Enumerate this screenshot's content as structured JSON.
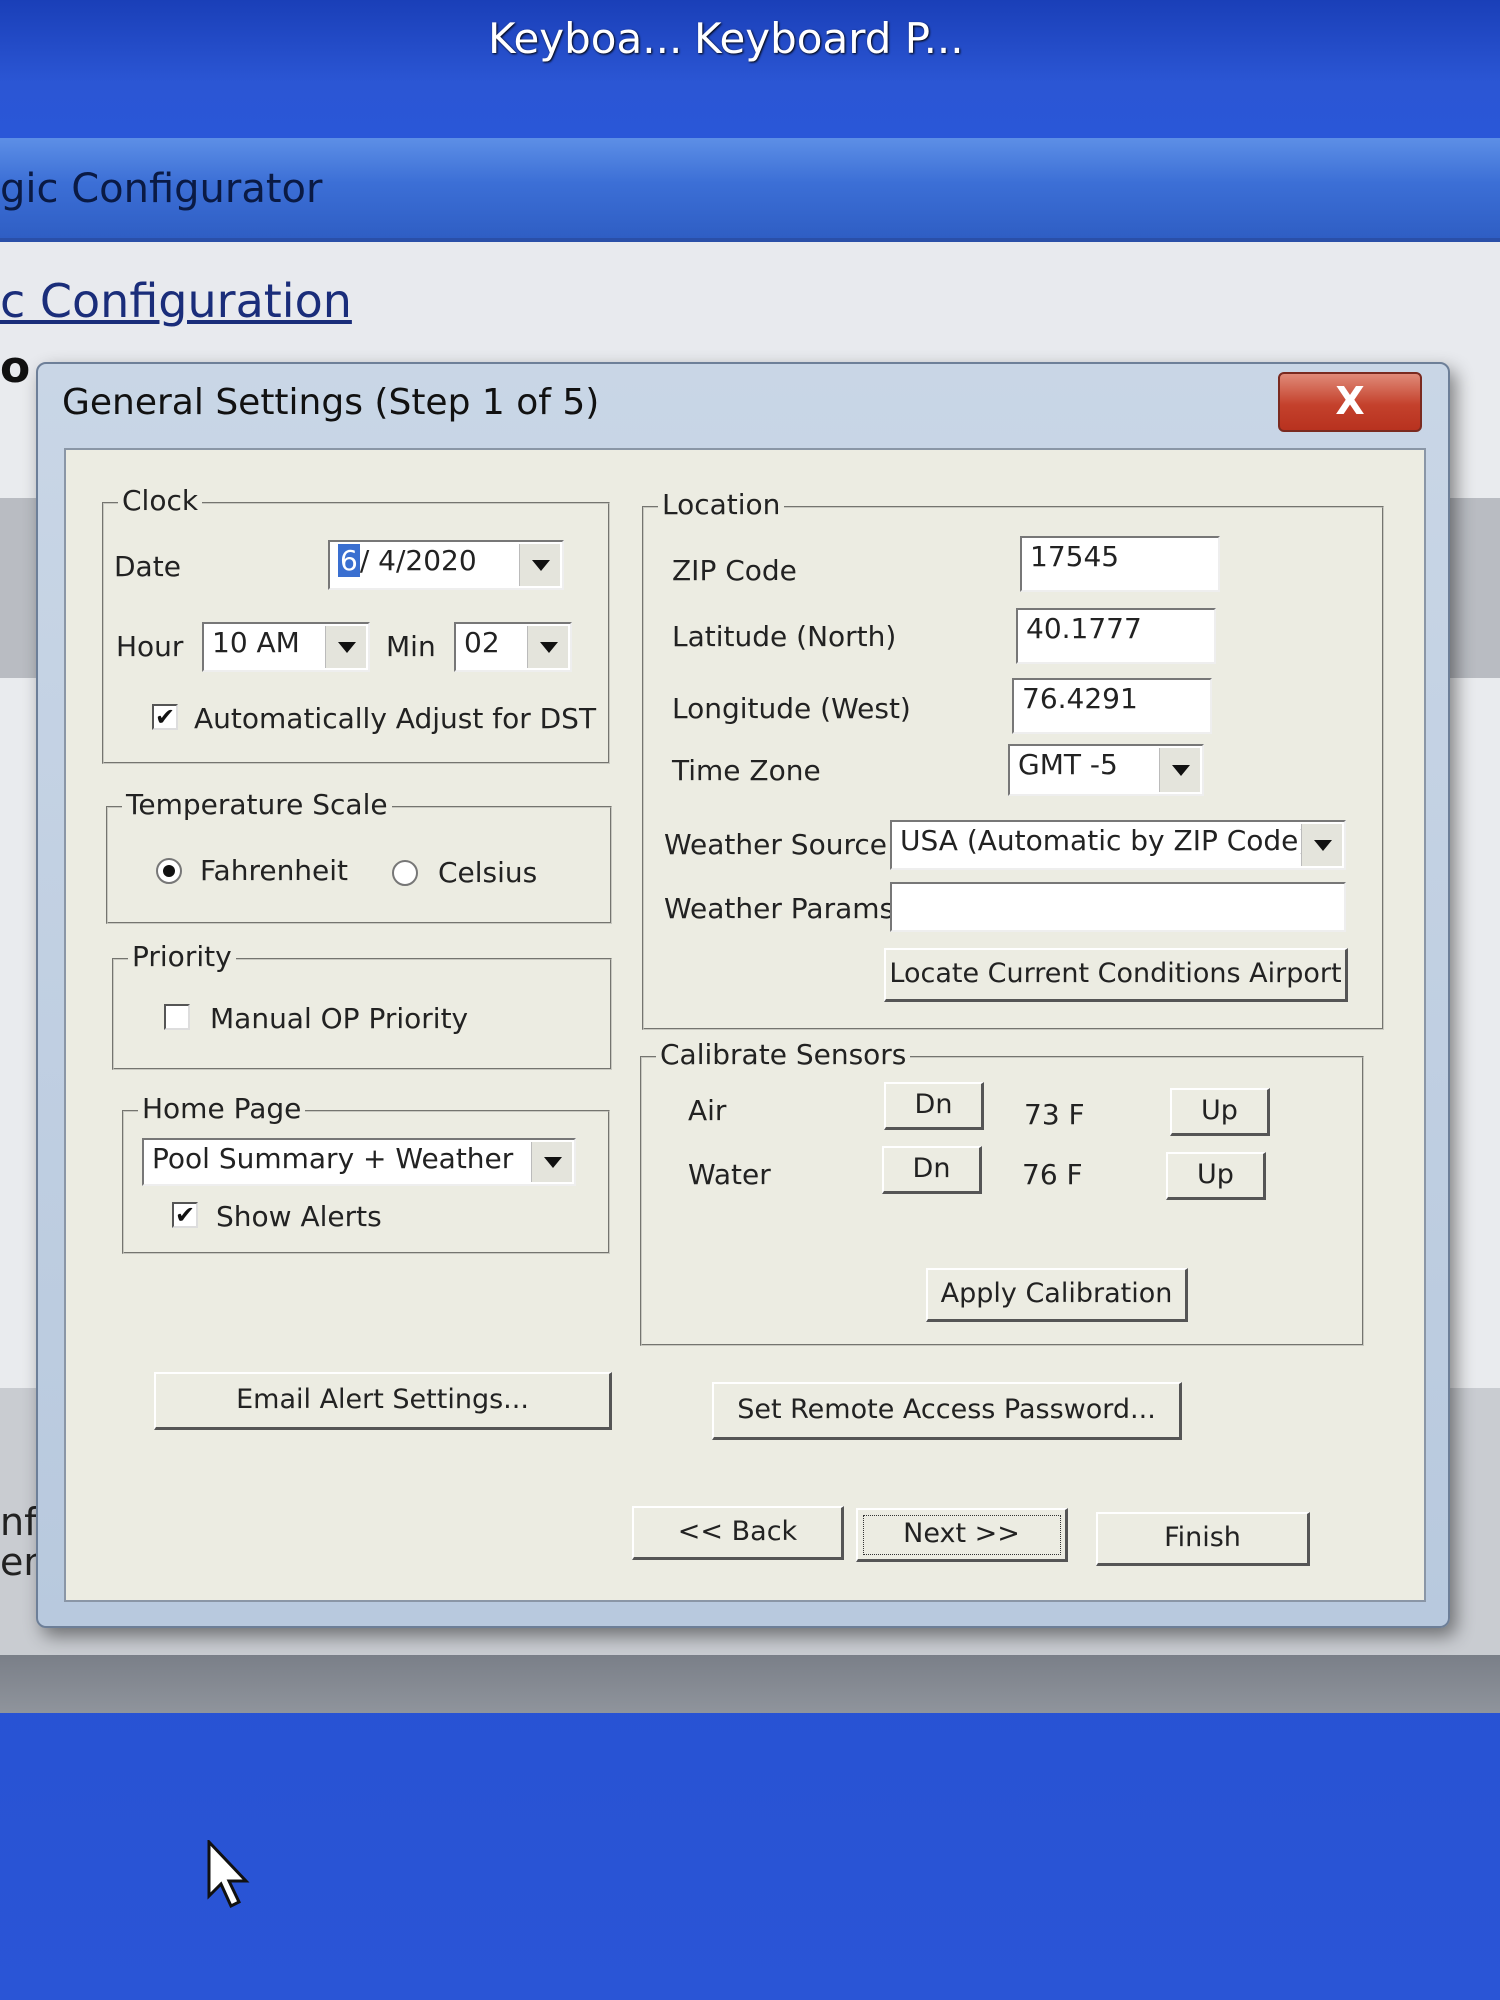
{
  "desktop": {
    "icons": [
      "Keyboa...",
      "Keyboard P..."
    ]
  },
  "background_window": {
    "title": "gic Configurator",
    "subtitle": "c Configuration",
    "subtitle2": "o",
    "left_text_1": "nfigure",
    "left_text_2": "enLog"
  },
  "dialog": {
    "title": "General Settings (Step 1 of 5)",
    "close_label": "X",
    "clock": {
      "legend": "Clock",
      "date_label": "Date",
      "date_day": "6",
      "date_rest": "/ 4/2020",
      "hour_label": "Hour",
      "hour_value": "10 AM",
      "min_label": "Min",
      "min_value": "02",
      "dst_label": "Automatically Adjust for DST",
      "dst_checked": "✔"
    },
    "temperature": {
      "legend": "Temperature Scale",
      "fahrenheit": "Fahrenheit",
      "celsius": "Celsius",
      "selected": "Fahrenheit"
    },
    "priority": {
      "legend": "Priority",
      "manual_op": "Manual OP Priority"
    },
    "home_page": {
      "legend": "Home Page",
      "value": "Pool Summary + Weather",
      "show_alerts": "Show Alerts",
      "show_alerts_checked": "✔"
    },
    "location": {
      "legend": "Location",
      "zip_label": "ZIP Code",
      "zip_value": "17545",
      "lat_label": "Latitude (North)",
      "lat_value": "40.1777",
      "lon_label": "Longitude (West)",
      "lon_value": "76.4291",
      "tz_label": "Time Zone",
      "tz_value": "GMT -5",
      "ws_label": "Weather Source",
      "ws_value": "USA (Automatic by ZIP Code)",
      "wp_label": "Weather Params",
      "wp_value": "",
      "locate_button": "Locate Current Conditions Airport"
    },
    "calibrate": {
      "legend": "Calibrate Sensors",
      "air_label": "Air",
      "air_value": "73 F",
      "water_label": "Water",
      "water_value": "76 F",
      "dn": "Dn",
      "up": "Up",
      "apply_button": "Apply Calibration"
    },
    "email_button": "Email Alert Settings...",
    "remote_button": "Set Remote Access Password...",
    "back_button": "<< Back",
    "next_button": "Next >>",
    "finish_button": "Finish"
  }
}
